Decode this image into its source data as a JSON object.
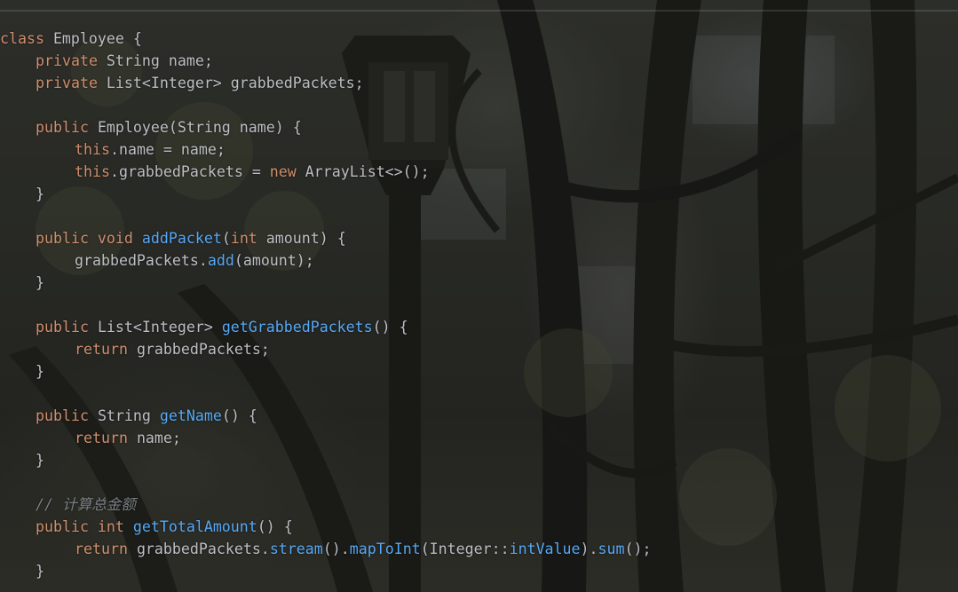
{
  "colors": {
    "keyword": "#cf8e6d",
    "function": "#56a8f5",
    "comment": "#7a7e85",
    "plain": "#bcbec4"
  },
  "code": {
    "lines": [
      {
        "indent": 0,
        "tokens": [
          {
            "t": "class",
            "c": "kw"
          },
          {
            "t": " Employee {",
            "c": "pl"
          }
        ]
      },
      {
        "indent": 1,
        "tokens": [
          {
            "t": "private",
            "c": "kw"
          },
          {
            "t": " String name;",
            "c": "pl"
          }
        ]
      },
      {
        "indent": 1,
        "tokens": [
          {
            "t": "private",
            "c": "kw"
          },
          {
            "t": " List<Integer> grabbedPackets;",
            "c": "pl"
          }
        ]
      },
      {
        "indent": 0,
        "tokens": []
      },
      {
        "indent": 1,
        "tokens": [
          {
            "t": "public",
            "c": "kw"
          },
          {
            "t": " Employee(String name) {",
            "c": "pl"
          }
        ]
      },
      {
        "indent": 2,
        "tokens": [
          {
            "t": "this",
            "c": "kw"
          },
          {
            "t": ".name = name;",
            "c": "pl"
          }
        ]
      },
      {
        "indent": 2,
        "tokens": [
          {
            "t": "this",
            "c": "kw"
          },
          {
            "t": ".grabbedPackets = ",
            "c": "pl"
          },
          {
            "t": "new",
            "c": "kw"
          },
          {
            "t": " ArrayList<>();",
            "c": "pl"
          }
        ]
      },
      {
        "indent": 1,
        "tokens": [
          {
            "t": "}",
            "c": "pl"
          }
        ]
      },
      {
        "indent": 0,
        "tokens": []
      },
      {
        "indent": 1,
        "tokens": [
          {
            "t": "public void",
            "c": "kw"
          },
          {
            "t": " ",
            "c": "pl"
          },
          {
            "t": "addPacket",
            "c": "fn"
          },
          {
            "t": "(",
            "c": "pl"
          },
          {
            "t": "int",
            "c": "kw"
          },
          {
            "t": " amount) {",
            "c": "pl"
          }
        ]
      },
      {
        "indent": 2,
        "tokens": [
          {
            "t": "grabbedPackets.",
            "c": "pl"
          },
          {
            "t": "add",
            "c": "fn"
          },
          {
            "t": "(amount);",
            "c": "pl"
          }
        ]
      },
      {
        "indent": 1,
        "tokens": [
          {
            "t": "}",
            "c": "pl"
          }
        ]
      },
      {
        "indent": 0,
        "tokens": []
      },
      {
        "indent": 1,
        "tokens": [
          {
            "t": "public",
            "c": "kw"
          },
          {
            "t": " List<Integer> ",
            "c": "pl"
          },
          {
            "t": "getGrabbedPackets",
            "c": "fn"
          },
          {
            "t": "() {",
            "c": "pl"
          }
        ]
      },
      {
        "indent": 2,
        "tokens": [
          {
            "t": "return",
            "c": "kw"
          },
          {
            "t": " grabbedPackets;",
            "c": "pl"
          }
        ]
      },
      {
        "indent": 1,
        "tokens": [
          {
            "t": "}",
            "c": "pl"
          }
        ]
      },
      {
        "indent": 0,
        "tokens": []
      },
      {
        "indent": 1,
        "tokens": [
          {
            "t": "public",
            "c": "kw"
          },
          {
            "t": " String ",
            "c": "pl"
          },
          {
            "t": "getName",
            "c": "fn"
          },
          {
            "t": "() {",
            "c": "pl"
          }
        ]
      },
      {
        "indent": 2,
        "tokens": [
          {
            "t": "return",
            "c": "kw"
          },
          {
            "t": " name;",
            "c": "pl"
          }
        ]
      },
      {
        "indent": 1,
        "tokens": [
          {
            "t": "}",
            "c": "pl"
          }
        ]
      },
      {
        "indent": 0,
        "tokens": []
      },
      {
        "indent": 1,
        "tokens": [
          {
            "t": "// 计算总金额",
            "c": "cm"
          }
        ]
      },
      {
        "indent": 1,
        "tokens": [
          {
            "t": "public int",
            "c": "kw"
          },
          {
            "t": " ",
            "c": "pl"
          },
          {
            "t": "getTotalAmount",
            "c": "fn"
          },
          {
            "t": "() {",
            "c": "pl"
          }
        ]
      },
      {
        "indent": 2,
        "tokens": [
          {
            "t": "return",
            "c": "kw"
          },
          {
            "t": " grabbedPackets.",
            "c": "pl"
          },
          {
            "t": "stream",
            "c": "fn"
          },
          {
            "t": "().",
            "c": "pl"
          },
          {
            "t": "mapToInt",
            "c": "fn"
          },
          {
            "t": "(Integer::",
            "c": "pl"
          },
          {
            "t": "intValue",
            "c": "fn"
          },
          {
            "t": ").",
            "c": "pl"
          },
          {
            "t": "sum",
            "c": "fn"
          },
          {
            "t": "();",
            "c": "pl"
          }
        ]
      },
      {
        "indent": 1,
        "tokens": [
          {
            "t": "}",
            "c": "pl"
          }
        ]
      }
    ]
  }
}
